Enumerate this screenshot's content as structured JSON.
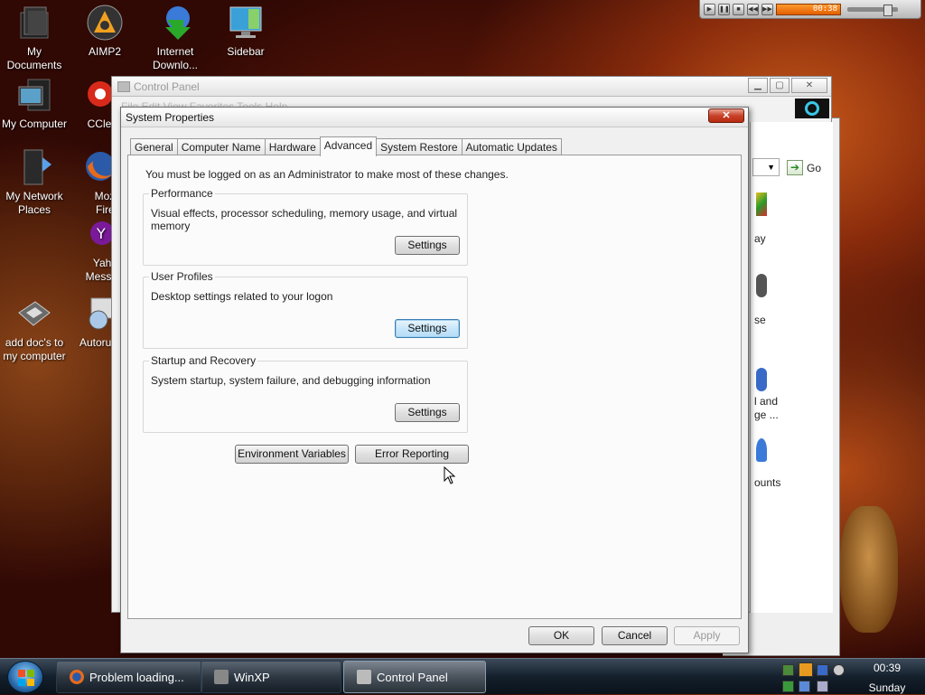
{
  "desktop": {
    "icons": [
      {
        "label": "My Documents"
      },
      {
        "label": "AIMP2"
      },
      {
        "label": "Internet Downlo..."
      },
      {
        "label": "Sidebar"
      },
      {
        "label": "My Computer"
      },
      {
        "label": "CClea"
      },
      {
        "label": "My Network Places"
      },
      {
        "label": "Mozi Firef"
      },
      {
        "label": "Yaho Messe"
      },
      {
        "label": "add doc's to my computer"
      },
      {
        "label": "Autorun"
      }
    ]
  },
  "media_player": {
    "time": "00:38"
  },
  "control_panel": {
    "title": "Control Panel",
    "menu": "File   Edit   View   Favorites   Tools   Help",
    "go_label": "Go",
    "partial_items": [
      "ay",
      "se",
      "l and",
      "ge ...",
      "ounts"
    ]
  },
  "dialog": {
    "title": "System Properties",
    "close_label": "✕",
    "tabs": [
      {
        "label": "General"
      },
      {
        "label": "Computer Name"
      },
      {
        "label": "Hardware"
      },
      {
        "label": "Advanced"
      },
      {
        "label": "System Restore"
      },
      {
        "label": "Automatic Updates"
      }
    ],
    "admin_note": "You must be logged on as an Administrator to make most of these changes.",
    "groups": [
      {
        "title": "Performance",
        "description": "Visual effects, processor scheduling, memory usage, and virtual memory",
        "button": "Settings"
      },
      {
        "title": "User Profiles",
        "description": "Desktop settings related to your logon",
        "button": "Settings"
      },
      {
        "title": "Startup and Recovery",
        "description": "System startup, system failure, and debugging information",
        "button": "Settings"
      }
    ],
    "env_button": "Environment Variables",
    "error_button": "Error Reporting",
    "ok": "OK",
    "cancel": "Cancel",
    "apply": "Apply"
  },
  "taskbar": {
    "buttons": [
      {
        "label": "Problem loading..."
      },
      {
        "label": "WinXP"
      },
      {
        "label": "Control Panel"
      }
    ],
    "clock_time": "00:39",
    "clock_day": "Sunday"
  },
  "colors": {
    "accent": "#3c7fb1",
    "close": "#c8422a",
    "media_progress": "#ff9a30"
  }
}
